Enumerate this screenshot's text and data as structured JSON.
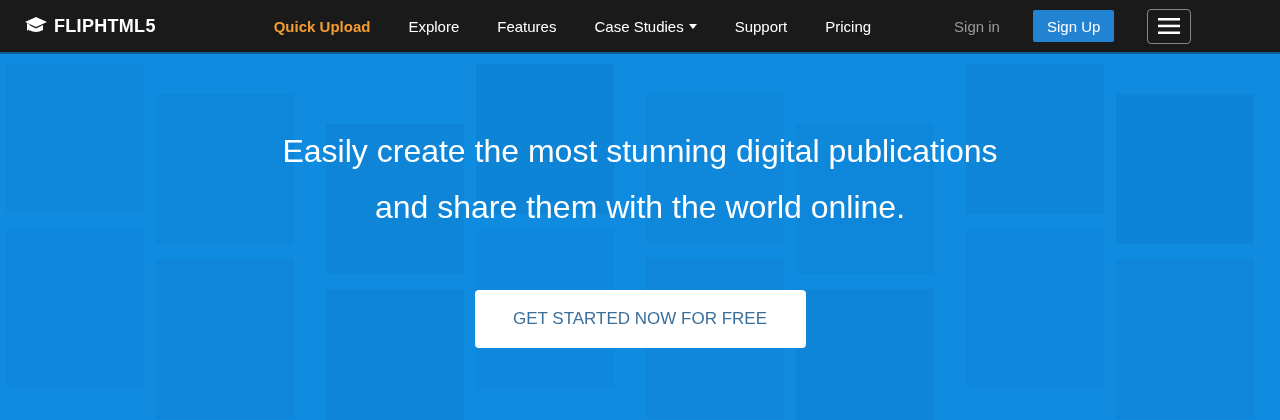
{
  "brand": {
    "name": "FLIPHTML5"
  },
  "nav": [
    {
      "label": "Quick Upload",
      "kind": "accent"
    },
    {
      "label": "Explore",
      "kind": "plain"
    },
    {
      "label": "Features",
      "kind": "plain"
    },
    {
      "label": "Case Studies",
      "kind": "dropdown"
    },
    {
      "label": "Support",
      "kind": "plain"
    },
    {
      "label": "Pricing",
      "kind": "plain"
    }
  ],
  "sign_in": {
    "label": "Sign in"
  },
  "sign_up": {
    "label": "Sign Up"
  },
  "hero": {
    "kind": "picture",
    "headline": [
      "Easily create the most stunning digital publications",
      "and share them with the world online."
    ],
    "cta": "GET STARTED NOW FOR FREE"
  }
}
